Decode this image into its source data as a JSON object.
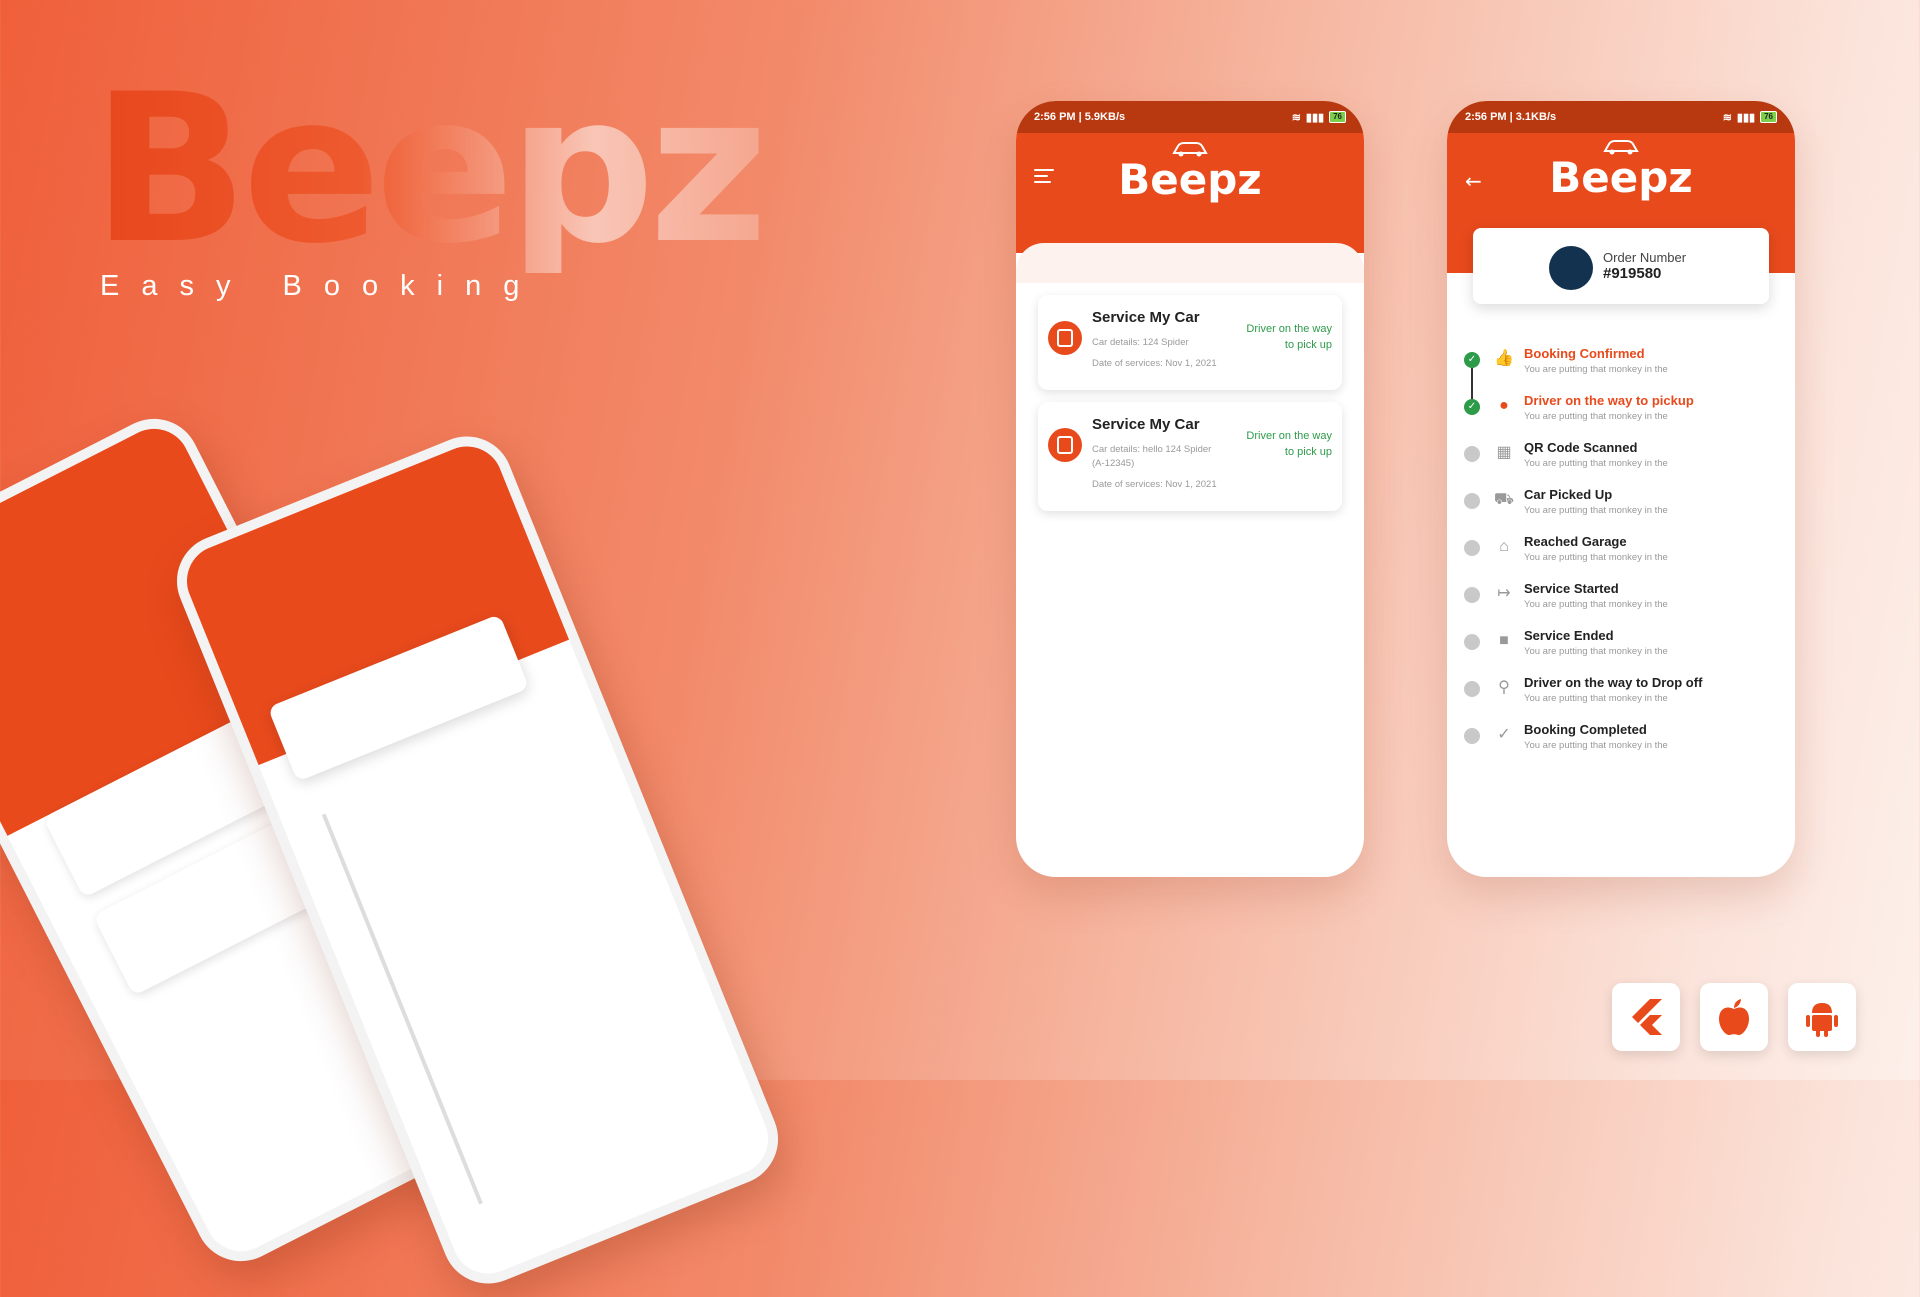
{
  "brand": {
    "name": "Beepz",
    "tagline": "Easy Booking"
  },
  "status_bar_left": {
    "time": "2:56 PM | 5.9KB/s",
    "time_alt": "2:56 PM | 3.1KB/s",
    "battery": "76"
  },
  "home_screen": {
    "title": "Beepz",
    "cards": [
      {
        "title": "Service My Car",
        "details": "Car details: 124 Spider",
        "date": "Date of services: Nov 1, 2021",
        "status": "Driver on the way to pick up"
      },
      {
        "title": "Service My Car",
        "details": "Car details: hello 124 Spider (A-12345)",
        "date": "Date of services: Nov 1, 2021",
        "status": "Driver on the way to pick up"
      }
    ]
  },
  "order_screen": {
    "title": "Beepz",
    "order_label": "Order Number",
    "order_number": "#919580",
    "steps": [
      {
        "title": "Booking Confirmed",
        "sub": "You are putting that monkey in the",
        "state": "done",
        "icon": "thumbs-up-icon",
        "glyph": "👍"
      },
      {
        "title": "Driver on the way to pickup",
        "sub": "You are putting that monkey in the",
        "state": "done",
        "icon": "person-icon",
        "glyph": "●"
      },
      {
        "title": "QR Code Scanned",
        "sub": "You are putting that monkey in the",
        "state": "pending",
        "icon": "qr-code-icon",
        "glyph": "▦"
      },
      {
        "title": "Car Picked Up",
        "sub": "You are putting that monkey in the",
        "state": "pending",
        "icon": "car-icon",
        "glyph": "⛟"
      },
      {
        "title": "Reached Garage",
        "sub": "You are putting that monkey in the",
        "state": "pending",
        "icon": "home-icon",
        "glyph": "⌂"
      },
      {
        "title": "Service Started",
        "sub": "You are putting that monkey in the",
        "state": "pending",
        "icon": "arrow-right-bar-icon",
        "glyph": "↦"
      },
      {
        "title": "Service Ended",
        "sub": "You are putting that monkey in the",
        "state": "pending",
        "icon": "stop-icon",
        "glyph": "■"
      },
      {
        "title": "Driver on the way to Drop off",
        "sub": "You are putting that monkey in the",
        "state": "pending",
        "icon": "location-pin-icon",
        "glyph": "⚲"
      },
      {
        "title": "Booking Completed",
        "sub": "You are putting that monkey in the",
        "state": "pending",
        "icon": "check-icon",
        "glyph": "✓"
      }
    ]
  },
  "platforms": [
    "flutter-icon",
    "apple-icon",
    "android-icon"
  ],
  "colors": {
    "accent": "#e84a1c",
    "status_bar": "#b8380f",
    "success": "#2e9b4a"
  }
}
